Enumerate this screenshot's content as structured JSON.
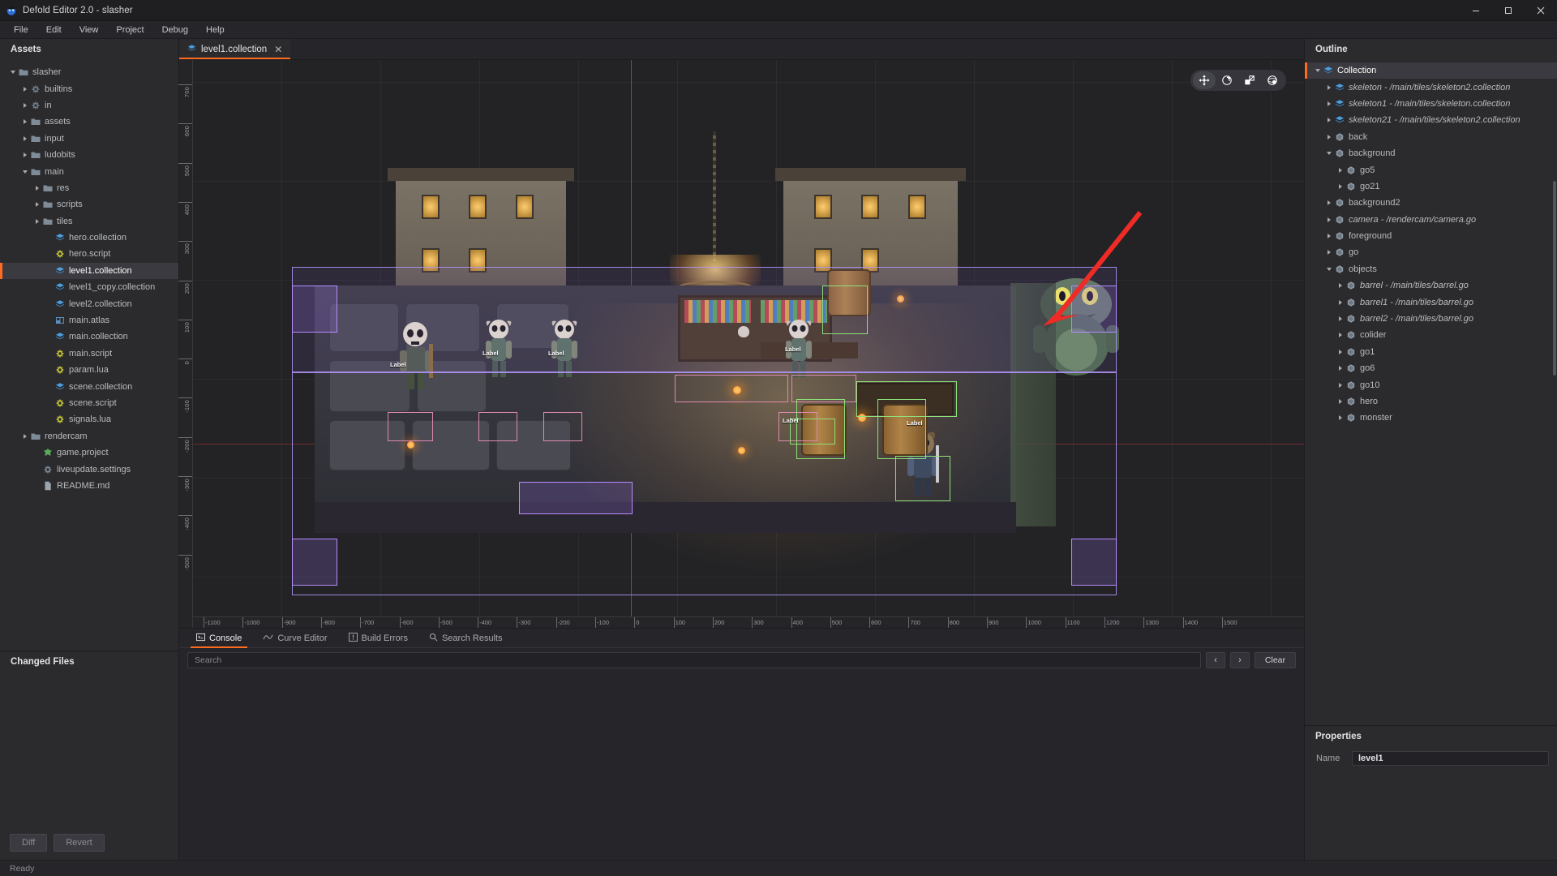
{
  "window": {
    "title": "Defold Editor 2.0 - slasher",
    "logo_icon": "defold-logo-icon",
    "minimize_label": "─",
    "maximize_label": "❐",
    "close_label": "✕"
  },
  "menubar": {
    "items": [
      {
        "label": "File"
      },
      {
        "label": "Edit"
      },
      {
        "label": "View"
      },
      {
        "label": "Project"
      },
      {
        "label": "Debug"
      },
      {
        "label": "Help"
      }
    ]
  },
  "assets": {
    "title": "Assets",
    "items": [
      {
        "label": "slasher",
        "depth": 0,
        "icon": "folder-icon",
        "caret": "open",
        "selected": false
      },
      {
        "label": "builtins",
        "depth": 1,
        "icon": "builtins-icon",
        "caret": "closed",
        "selected": false
      },
      {
        "label": "in",
        "depth": 1,
        "icon": "builtins-icon",
        "caret": "closed",
        "selected": false
      },
      {
        "label": "assets",
        "depth": 1,
        "icon": "folder-icon",
        "caret": "closed",
        "selected": false
      },
      {
        "label": "input",
        "depth": 1,
        "icon": "folder-icon",
        "caret": "closed",
        "selected": false
      },
      {
        "label": "ludobits",
        "depth": 1,
        "icon": "folder-icon",
        "caret": "closed",
        "selected": false
      },
      {
        "label": "main",
        "depth": 1,
        "icon": "folder-icon",
        "caret": "open",
        "selected": false
      },
      {
        "label": "res",
        "depth": 2,
        "icon": "folder-icon",
        "caret": "closed",
        "selected": false
      },
      {
        "label": "scripts",
        "depth": 2,
        "icon": "folder-icon",
        "caret": "closed",
        "selected": false
      },
      {
        "label": "tiles",
        "depth": 2,
        "icon": "folder-icon",
        "caret": "closed",
        "selected": false
      },
      {
        "label": "hero.collection",
        "depth": 3,
        "icon": "collection-icon",
        "caret": "none",
        "selected": false
      },
      {
        "label": "hero.script",
        "depth": 3,
        "icon": "script-icon",
        "caret": "none",
        "selected": false
      },
      {
        "label": "level1.collection",
        "depth": 3,
        "icon": "collection-icon",
        "caret": "none",
        "selected": true
      },
      {
        "label": "level1_copy.collection",
        "depth": 3,
        "icon": "collection-icon",
        "caret": "none",
        "selected": false
      },
      {
        "label": "level2.collection",
        "depth": 3,
        "icon": "collection-icon",
        "caret": "none",
        "selected": false
      },
      {
        "label": "main.atlas",
        "depth": 3,
        "icon": "atlas-icon",
        "caret": "none",
        "selected": false
      },
      {
        "label": "main.collection",
        "depth": 3,
        "icon": "collection-icon",
        "caret": "none",
        "selected": false
      },
      {
        "label": "main.script",
        "depth": 3,
        "icon": "script-icon",
        "caret": "none",
        "selected": false
      },
      {
        "label": "param.lua",
        "depth": 3,
        "icon": "script-icon",
        "caret": "none",
        "selected": false
      },
      {
        "label": "scene.collection",
        "depth": 3,
        "icon": "collection-icon",
        "caret": "none",
        "selected": false
      },
      {
        "label": "scene.script",
        "depth": 3,
        "icon": "script-icon",
        "caret": "none",
        "selected": false
      },
      {
        "label": "signals.lua",
        "depth": 3,
        "icon": "script-icon",
        "caret": "none",
        "selected": false
      },
      {
        "label": "rendercam",
        "depth": 1,
        "icon": "folder-icon",
        "caret": "closed",
        "selected": false
      },
      {
        "label": "game.project",
        "depth": 2,
        "icon": "project-icon",
        "caret": "none",
        "selected": false
      },
      {
        "label": "liveupdate.settings",
        "depth": 2,
        "icon": "settings-icon",
        "caret": "none",
        "selected": false
      },
      {
        "label": "README.md",
        "depth": 2,
        "icon": "file-icon",
        "caret": "none",
        "selected": false
      }
    ]
  },
  "changed_files": {
    "title": "Changed Files",
    "diff_label": "Diff",
    "revert_label": "Revert"
  },
  "editor_tabs": [
    {
      "label": "level1.collection",
      "icon": "collection-icon",
      "close_label": "✕",
      "active": true
    }
  ],
  "viewport": {
    "tools": [
      {
        "name": "move-tool",
        "active": true
      },
      {
        "name": "rotate-tool",
        "active": false
      },
      {
        "name": "scale-tool",
        "active": false
      },
      {
        "name": "camera-tool",
        "active": false
      }
    ],
    "h_ruler_labels": [
      "-1100",
      "-1000",
      "-900",
      "-800",
      "-700",
      "-600",
      "-500",
      "-400",
      "-300",
      "-200",
      "-100",
      "0",
      "100",
      "200",
      "300",
      "400",
      "500",
      "600",
      "700",
      "800",
      "900",
      "1000",
      "1100",
      "1200",
      "1300",
      "1400",
      "1500"
    ],
    "v_ruler_labels": [
      "700",
      "600",
      "500",
      "400",
      "300",
      "200",
      "100",
      "0",
      "-100",
      "-200",
      "-300",
      "-400",
      "-500"
    ],
    "scene_labels": [
      "Label",
      "Label",
      "Label",
      "Label",
      "Label",
      "Label"
    ],
    "annotation": {
      "name": "red-arrow-annotation",
      "color": "#ef2b25"
    }
  },
  "console": {
    "tabs": [
      {
        "label": "Console",
        "icon": "console-icon",
        "active": true
      },
      {
        "label": "Curve Editor",
        "icon": "curve-icon",
        "active": false
      },
      {
        "label": "Build Errors",
        "icon": "build-errors-icon",
        "active": false
      },
      {
        "label": "Search Results",
        "icon": "search-icon",
        "active": false
      }
    ],
    "search_placeholder": "Search",
    "search_value": "",
    "prev_label": "‹",
    "next_label": "›",
    "clear_label": "Clear"
  },
  "outline": {
    "title": "Outline",
    "items": [
      {
        "label": "Collection",
        "depth": 0,
        "icon": "collection-icon",
        "caret": "open",
        "selected": true,
        "italic": false
      },
      {
        "label": "skeleton - /main/tiles/skeleton2.collection",
        "depth": 1,
        "icon": "collection-icon",
        "caret": "closed",
        "selected": false,
        "italic": true
      },
      {
        "label": "skeleton1 - /main/tiles/skeleton.collection",
        "depth": 1,
        "icon": "collection-icon",
        "caret": "closed",
        "selected": false,
        "italic": true
      },
      {
        "label": "skeleton21 - /main/tiles/skeleton2.collection",
        "depth": 1,
        "icon": "collection-icon",
        "caret": "closed",
        "selected": false,
        "italic": true
      },
      {
        "label": "back",
        "depth": 1,
        "icon": "gameobject-icon",
        "caret": "closed",
        "selected": false,
        "italic": false
      },
      {
        "label": "background",
        "depth": 1,
        "icon": "gameobject-icon",
        "caret": "open",
        "selected": false,
        "italic": false
      },
      {
        "label": "go5",
        "depth": 2,
        "icon": "gameobject-icon",
        "caret": "closed",
        "selected": false,
        "italic": false
      },
      {
        "label": "go21",
        "depth": 2,
        "icon": "gameobject-icon",
        "caret": "closed",
        "selected": false,
        "italic": false
      },
      {
        "label": "background2",
        "depth": 1,
        "icon": "gameobject-icon",
        "caret": "closed",
        "selected": false,
        "italic": false
      },
      {
        "label": "camera - /rendercam/camera.go",
        "depth": 1,
        "icon": "gameobject-icon",
        "caret": "closed",
        "selected": false,
        "italic": true
      },
      {
        "label": "foreground",
        "depth": 1,
        "icon": "gameobject-icon",
        "caret": "closed",
        "selected": false,
        "italic": false
      },
      {
        "label": "go",
        "depth": 1,
        "icon": "gameobject-icon",
        "caret": "closed",
        "selected": false,
        "italic": false
      },
      {
        "label": "objects",
        "depth": 1,
        "icon": "gameobject-icon",
        "caret": "open",
        "selected": false,
        "italic": false
      },
      {
        "label": "barrel - /main/tiles/barrel.go",
        "depth": 2,
        "icon": "gameobject-icon",
        "caret": "closed",
        "selected": false,
        "italic": true
      },
      {
        "label": "barrel1 - /main/tiles/barrel.go",
        "depth": 2,
        "icon": "gameobject-icon",
        "caret": "closed",
        "selected": false,
        "italic": true
      },
      {
        "label": "barrel2 - /main/tiles/barrel.go",
        "depth": 2,
        "icon": "gameobject-icon",
        "caret": "closed",
        "selected": false,
        "italic": true
      },
      {
        "label": "colider",
        "depth": 2,
        "icon": "gameobject-icon",
        "caret": "closed",
        "selected": false,
        "italic": false
      },
      {
        "label": "go1",
        "depth": 2,
        "icon": "gameobject-icon",
        "caret": "closed",
        "selected": false,
        "italic": false
      },
      {
        "label": "go6",
        "depth": 2,
        "icon": "gameobject-icon",
        "caret": "closed",
        "selected": false,
        "italic": false
      },
      {
        "label": "go10",
        "depth": 2,
        "icon": "gameobject-icon",
        "caret": "closed",
        "selected": false,
        "italic": false
      },
      {
        "label": "hero",
        "depth": 2,
        "icon": "gameobject-icon",
        "caret": "closed",
        "selected": false,
        "italic": false
      },
      {
        "label": "monster",
        "depth": 2,
        "icon": "gameobject-icon",
        "caret": "closed",
        "selected": false,
        "italic": false
      }
    ]
  },
  "properties": {
    "title": "Properties",
    "name_label": "Name",
    "name_value": "level1"
  },
  "statusbar": {
    "text": "Ready"
  },
  "colors": {
    "accent": "#ff6c20",
    "panel": "#2b2b2e",
    "annotation": "#ef2b25"
  }
}
